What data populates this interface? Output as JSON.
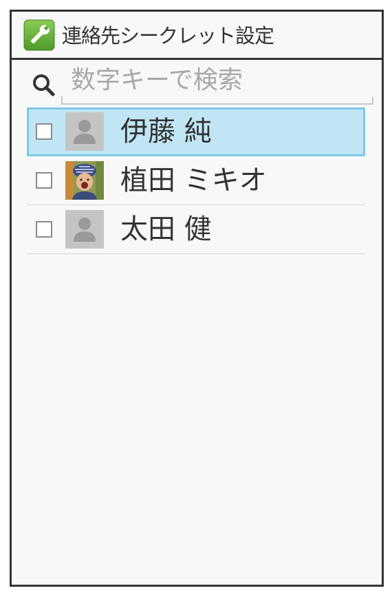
{
  "header": {
    "title": "連絡先シークレット設定",
    "icon": "wrench-icon",
    "icon_color": "#6db33f"
  },
  "search": {
    "placeholder": "数字キーで検索",
    "icon": "search-icon"
  },
  "contacts": [
    {
      "name": "伊藤 純",
      "checked": false,
      "selected": true,
      "avatar": "default-avatar"
    },
    {
      "name": "植田 ミキオ",
      "checked": false,
      "selected": false,
      "avatar": "photo-avatar"
    },
    {
      "name": "太田 健",
      "checked": false,
      "selected": false,
      "avatar": "default-avatar"
    }
  ],
  "colors": {
    "selected_background": "#c0e6f5",
    "selected_border": "#7cc8e8",
    "text": "#333333",
    "placeholder": "#a8a8a8"
  }
}
